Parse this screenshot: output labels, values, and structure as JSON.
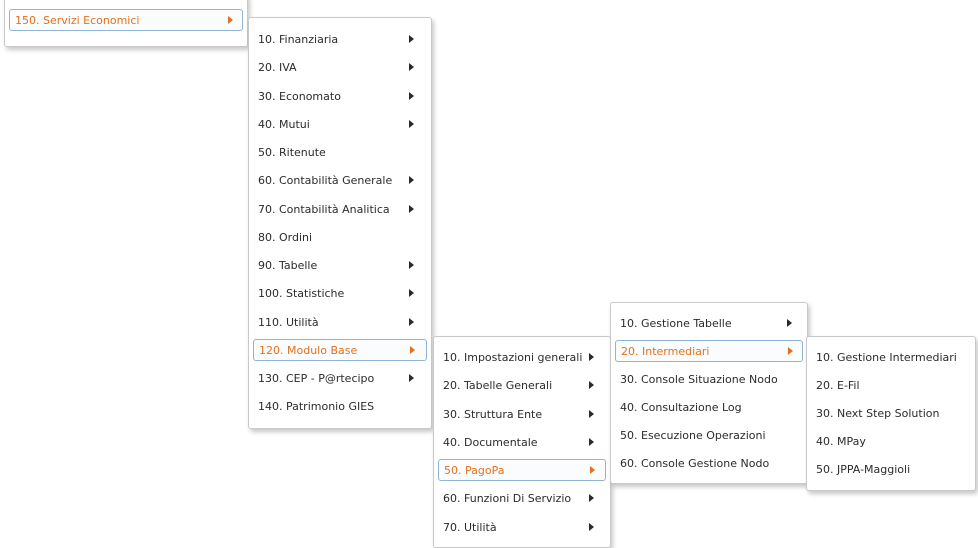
{
  "menus": {
    "root": {
      "items": [
        {
          "label": "150. Servizi Economici",
          "submenu": true,
          "active": true
        }
      ]
    },
    "servizi_economici": {
      "items": [
        {
          "label": "10. Finanziaria",
          "submenu": true
        },
        {
          "label": "20. IVA",
          "submenu": true
        },
        {
          "label": "30. Economato",
          "submenu": true
        },
        {
          "label": "40. Mutui",
          "submenu": true
        },
        {
          "label": "50. Ritenute",
          "submenu": false
        },
        {
          "label": "60. Contabilità Generale",
          "submenu": true
        },
        {
          "label": "70. Contabilità Analitica",
          "submenu": true
        },
        {
          "label": "80. Ordini",
          "submenu": false
        },
        {
          "label": "90. Tabelle",
          "submenu": true
        },
        {
          "label": "100. Statistiche",
          "submenu": true
        },
        {
          "label": "110. Utilità",
          "submenu": true
        },
        {
          "label": "120. Modulo Base",
          "submenu": true,
          "active": true
        },
        {
          "label": "130. CEP - P@rtecipo",
          "submenu": true
        },
        {
          "label": "140. Patrimonio GIES",
          "submenu": false
        }
      ]
    },
    "modulo_base": {
      "items": [
        {
          "label": "10. Impostazioni generali",
          "submenu": true
        },
        {
          "label": "20. Tabelle Generali",
          "submenu": true
        },
        {
          "label": "30. Struttura Ente",
          "submenu": true
        },
        {
          "label": "40. Documentale",
          "submenu": true
        },
        {
          "label": "50. PagoPa",
          "submenu": true,
          "active": true
        },
        {
          "label": "60. Funzioni Di Servizio",
          "submenu": true
        },
        {
          "label": "70. Utilità",
          "submenu": true
        }
      ]
    },
    "pagopa": {
      "items": [
        {
          "label": "10. Gestione Tabelle",
          "submenu": true
        },
        {
          "label": "20. Intermediari",
          "submenu": true,
          "active": true
        },
        {
          "label": "30. Console Situazione Nodo",
          "submenu": false
        },
        {
          "label": "40. Consultazione Log",
          "submenu": false
        },
        {
          "label": "50. Esecuzione Operazioni",
          "submenu": false
        },
        {
          "label": "60. Console Gestione Nodo",
          "submenu": false
        }
      ]
    },
    "intermediari": {
      "items": [
        {
          "label": "10. Gestione Intermediari",
          "submenu": false
        },
        {
          "label": "20. E-Fil",
          "submenu": false
        },
        {
          "label": "30. Next Step Solution",
          "submenu": false
        },
        {
          "label": "40. MPay",
          "submenu": false
        },
        {
          "label": "50. JPPA-Maggioli",
          "submenu": false
        }
      ]
    }
  },
  "colors": {
    "active_text": "#e2711d",
    "active_border": "#8fb4d6",
    "menu_border": "#c9c9c9"
  },
  "icons": {
    "submenu": "triangle-right-icon"
  }
}
